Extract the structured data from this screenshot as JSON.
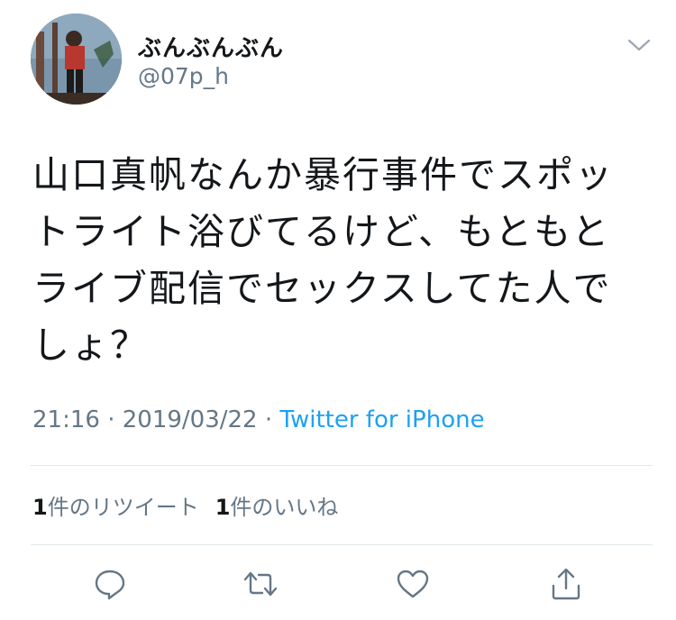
{
  "user": {
    "display_name": "ぶんぶんぶん",
    "handle": "@07p_h"
  },
  "tweet": {
    "text": "山口真帆なんか暴行事件でスポッ\nトライト浴びてるけど、もともと\nライブ配信でセックスしてた人で\nしょ？",
    "time": "21:16",
    "separator1": " · ",
    "date": "2019/03/22",
    "separator2": " · ",
    "source": "Twitter for iPhone"
  },
  "stats": {
    "retweet_count": "1",
    "retweet_label": "件のリツイート",
    "like_count": "1",
    "like_label": "件のいいね"
  },
  "icons": {
    "caret": "chevron-down-icon",
    "reply": "reply-icon",
    "retweet": "retweet-icon",
    "like": "heart-icon",
    "share": "share-icon"
  },
  "colors": {
    "text": "#14171a",
    "secondary": "#657786",
    "link": "#1da1f2",
    "divider": "#e1e8ed"
  }
}
